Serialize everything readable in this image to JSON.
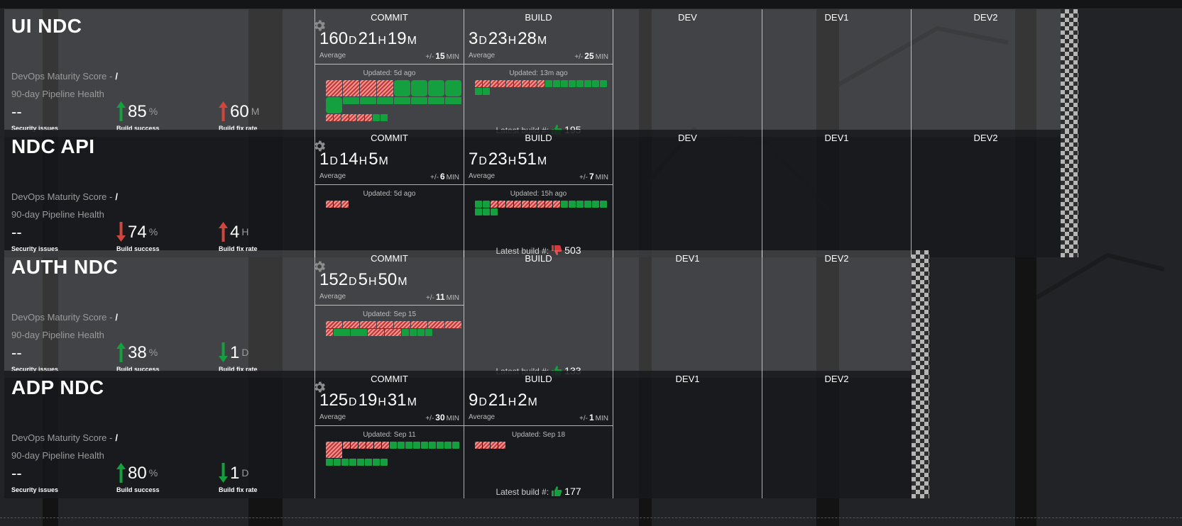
{
  "colors": {
    "success": "#14a03e",
    "failure": "#c0393a",
    "trend_up_good": "#14a03e",
    "trend_up_bad": "#d0463d"
  },
  "labels": {
    "maturity": "DevOps Maturity Score -",
    "maturity_value": "/",
    "health": "90-day Pipeline Health",
    "security": "Security issues",
    "build_success": "Build success",
    "fix_rate": "Build fix rate",
    "average": "Average",
    "deviation_prefix": "+/-",
    "deviation_unit": "MIN",
    "latest_build": "Latest build #:",
    "unit_d": "D",
    "unit_h": "H",
    "unit_m": "M"
  },
  "teams": [
    {
      "name": "UI NDC",
      "security": "--",
      "build_success": {
        "value": "85",
        "unit": "%",
        "trend": "up",
        "color": "green"
      },
      "fix_rate": {
        "value": "60",
        "unit": "M",
        "trend": "up",
        "color": "red"
      },
      "commit": {
        "label": "COMMIT",
        "d": "160",
        "h": "21",
        "m": "19",
        "deviation": "15",
        "updated": "Updated: 5d ago",
        "blocks": [
          {
            "s": "f",
            "z": "big"
          },
          {
            "s": "f",
            "z": "big"
          },
          {
            "s": "f",
            "z": "big"
          },
          {
            "s": "f",
            "z": "big"
          },
          {
            "s": "o",
            "z": "big"
          },
          {
            "s": "o",
            "z": "big"
          },
          {
            "s": "o",
            "z": "big"
          },
          {
            "s": "o",
            "z": "big"
          },
          {
            "s": "o",
            "z": "big"
          },
          {
            "s": "o",
            "z": "small"
          },
          {
            "s": "o",
            "z": "small"
          },
          {
            "s": "o",
            "z": "small"
          },
          {
            "s": "o",
            "z": "small"
          },
          {
            "s": "o",
            "z": "small"
          },
          {
            "s": "o",
            "z": "small"
          },
          {
            "s": "o",
            "z": "small"
          },
          {
            "s": "f",
            "z": "mini"
          },
          {
            "s": "f",
            "z": "mini"
          },
          {
            "s": "f",
            "z": "mini"
          },
          {
            "s": "f",
            "z": "mini"
          },
          {
            "s": "f",
            "z": "mini"
          },
          {
            "s": "f",
            "z": "mini"
          },
          {
            "s": "o",
            "z": "mini"
          },
          {
            "s": "o",
            "z": "mini"
          }
        ]
      },
      "build": {
        "label": "BUILD",
        "d": "3",
        "h": "23",
        "m": "28",
        "deviation": "25",
        "updated": "Updated: 13m ago",
        "latest": "195",
        "result": "up",
        "blocks": [
          {
            "s": "f",
            "z": "mini"
          },
          {
            "s": "f",
            "z": "mini"
          },
          {
            "s": "f",
            "z": "mini"
          },
          {
            "s": "f",
            "z": "mini"
          },
          {
            "s": "f",
            "z": "mini"
          },
          {
            "s": "f",
            "z": "mini"
          },
          {
            "s": "f",
            "z": "mini"
          },
          {
            "s": "f",
            "z": "mini"
          },
          {
            "s": "f",
            "z": "mini"
          },
          {
            "s": "o",
            "z": "mini"
          },
          {
            "s": "o",
            "z": "mini"
          },
          {
            "s": "o",
            "z": "mini"
          },
          {
            "s": "o",
            "z": "mini"
          },
          {
            "s": "o",
            "z": "mini"
          },
          {
            "s": "o",
            "z": "mini"
          },
          {
            "s": "o",
            "z": "mini"
          },
          {
            "s": "o",
            "z": "mini"
          },
          {
            "s": "o",
            "z": "mini"
          },
          {
            "s": "o",
            "z": "mini"
          }
        ]
      },
      "envs": [
        "DEV",
        "DEV1",
        "DEV2"
      ]
    },
    {
      "name": "NDC API",
      "security": "--",
      "build_success": {
        "value": "74",
        "unit": "%",
        "trend": "down",
        "color": "red"
      },
      "fix_rate": {
        "value": "4",
        "unit": "H",
        "trend": "up",
        "color": "red"
      },
      "commit": {
        "label": "COMMIT",
        "d": "1",
        "h": "14",
        "m": "5",
        "deviation": "6",
        "updated": "Updated: 5d ago",
        "blocks": [
          {
            "s": "f",
            "z": "mini"
          },
          {
            "s": "f",
            "z": "mini"
          },
          {
            "s": "f",
            "z": "mini"
          }
        ]
      },
      "build": {
        "label": "BUILD",
        "d": "7",
        "h": "23",
        "m": "51",
        "deviation": "7",
        "updated": "Updated: 15h ago",
        "latest": "503",
        "result": "down",
        "blocks": [
          {
            "s": "o",
            "z": "mini"
          },
          {
            "s": "o",
            "z": "mini"
          },
          {
            "s": "f",
            "z": "mini"
          },
          {
            "s": "f",
            "z": "mini"
          },
          {
            "s": "f",
            "z": "mini"
          },
          {
            "s": "f",
            "z": "mini"
          },
          {
            "s": "f",
            "z": "mini"
          },
          {
            "s": "f",
            "z": "mini"
          },
          {
            "s": "f",
            "z": "mini"
          },
          {
            "s": "f",
            "z": "mini"
          },
          {
            "s": "f",
            "z": "mini"
          },
          {
            "s": "o",
            "z": "mini"
          },
          {
            "s": "o",
            "z": "mini"
          },
          {
            "s": "o",
            "z": "mini"
          },
          {
            "s": "o",
            "z": "mini"
          },
          {
            "s": "o",
            "z": "mini"
          },
          {
            "s": "o",
            "z": "mini"
          },
          {
            "s": "o",
            "z": "mini"
          },
          {
            "s": "o",
            "z": "mini"
          },
          {
            "s": "o",
            "z": "mini"
          }
        ]
      },
      "envs": [
        "DEV",
        "DEV1",
        "DEV2"
      ]
    },
    {
      "name": "AUTH NDC",
      "security": "--",
      "build_success": {
        "value": "38",
        "unit": "%",
        "trend": "up",
        "color": "green"
      },
      "fix_rate": {
        "value": "1",
        "unit": "D",
        "trend": "down",
        "color": "green"
      },
      "commit": {
        "label": "COMMIT",
        "d": "152",
        "h": "5",
        "m": "50",
        "deviation": "11",
        "updated": "Updated: Sep 15",
        "blocks": [
          {
            "s": "f",
            "z": "small"
          },
          {
            "s": "f",
            "z": "small"
          },
          {
            "s": "f",
            "z": "small"
          },
          {
            "s": "f",
            "z": "small"
          },
          {
            "s": "f",
            "z": "small"
          },
          {
            "s": "f",
            "z": "small"
          },
          {
            "s": "f",
            "z": "small"
          },
          {
            "s": "f",
            "z": "small"
          },
          {
            "s": "f",
            "z": "mini"
          },
          {
            "s": "o",
            "z": "small"
          },
          {
            "s": "o",
            "z": "small"
          },
          {
            "s": "f",
            "z": "small"
          },
          {
            "s": "f",
            "z": "small"
          },
          {
            "s": "o",
            "z": "mini"
          },
          {
            "s": "o",
            "z": "mini"
          },
          {
            "s": "o",
            "z": "mini"
          },
          {
            "s": "o",
            "z": "mini"
          }
        ]
      },
      "build": {
        "label": "BUILD",
        "latest": "133",
        "result": "up"
      },
      "envs": [
        "DEV1",
        "DEV2"
      ]
    },
    {
      "name": "ADP NDC",
      "security": "--",
      "build_success": {
        "value": "80",
        "unit": "%",
        "trend": "up",
        "color": "green"
      },
      "fix_rate": {
        "value": "1",
        "unit": "D",
        "trend": "down",
        "color": "green"
      },
      "commit": {
        "label": "COMMIT",
        "d": "125",
        "h": "19",
        "m": "31",
        "deviation": "30",
        "updated": "Updated: Sep 11",
        "blocks": [
          {
            "s": "f",
            "z": "big"
          },
          {
            "s": "f",
            "z": "mini"
          },
          {
            "s": "f",
            "z": "mini"
          },
          {
            "s": "f",
            "z": "mini"
          },
          {
            "s": "f",
            "z": "mini"
          },
          {
            "s": "f",
            "z": "mini"
          },
          {
            "s": "f",
            "z": "mini"
          },
          {
            "s": "o",
            "z": "mini"
          },
          {
            "s": "o",
            "z": "mini"
          },
          {
            "s": "o",
            "z": "mini"
          },
          {
            "s": "o",
            "z": "mini"
          },
          {
            "s": "o",
            "z": "mini"
          },
          {
            "s": "o",
            "z": "mini"
          },
          {
            "s": "o",
            "z": "mini"
          },
          {
            "s": "o",
            "z": "mini"
          },
          {
            "s": "o",
            "z": "mini"
          },
          {
            "s": "o",
            "z": "mini"
          },
          {
            "s": "o",
            "z": "mini"
          },
          {
            "s": "o",
            "z": "mini"
          },
          {
            "s": "o",
            "z": "mini"
          },
          {
            "s": "o",
            "z": "mini"
          },
          {
            "s": "o",
            "z": "mini"
          },
          {
            "s": "o",
            "z": "mini"
          },
          {
            "s": "o",
            "z": "mini"
          }
        ]
      },
      "build": {
        "label": "BUILD",
        "d": "9",
        "h": "21",
        "m": "2",
        "deviation": "1",
        "updated": "Updated: Sep 18",
        "latest": "177",
        "result": "up",
        "blocks": [
          {
            "s": "f",
            "z": "mini"
          },
          {
            "s": "f",
            "z": "mini"
          },
          {
            "s": "f",
            "z": "mini"
          },
          {
            "s": "f",
            "z": "mini"
          }
        ]
      },
      "envs": [
        "DEV1",
        "DEV2"
      ]
    }
  ]
}
